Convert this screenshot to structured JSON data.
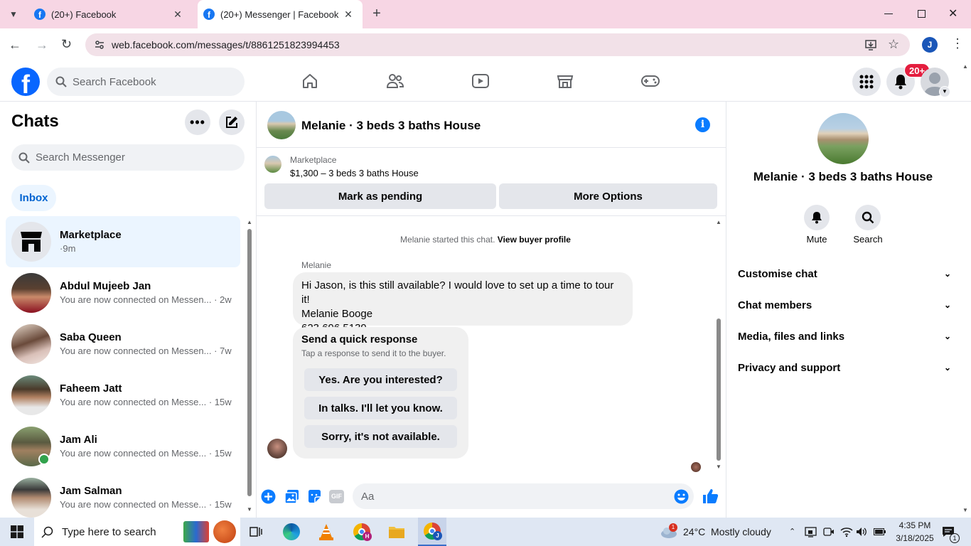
{
  "browser": {
    "tabs": [
      {
        "title": "(20+) Facebook"
      },
      {
        "title": "(20+) Messenger | Facebook"
      }
    ],
    "url": "web.facebook.com/messages/t/8861251823994453",
    "profile_initial": "J"
  },
  "fb": {
    "search_placeholder": "Search Facebook",
    "notification_badge": "20+",
    "logo_letter": "f"
  },
  "sidebar": {
    "title": "Chats",
    "search_placeholder": "Search Messenger",
    "filter_inbox": "Inbox",
    "chats": [
      {
        "name": "Marketplace",
        "snippet": "",
        "time": "9m",
        "selected": true
      },
      {
        "name": "Abdul Mujeeb Jan",
        "snippet": "You are now connected on Messen...",
        "time": "2w"
      },
      {
        "name": "Saba Queen",
        "snippet": "You are now connected on Messen...",
        "time": "7w"
      },
      {
        "name": "Faheem Jatt",
        "snippet": "You are now connected on Messe...",
        "time": "15w"
      },
      {
        "name": "Jam Ali",
        "snippet": "You are now connected on Messe...",
        "time": "15w",
        "online": true
      },
      {
        "name": "Jam Salman",
        "snippet": "You are now connected on Messe...",
        "time": "15w"
      }
    ]
  },
  "conversation": {
    "title": "Melanie · 3 beds 3 baths House",
    "marketplace_label": "Marketplace",
    "listing": "$1,300 – 3 beds 3 baths House",
    "mark_pending": "Mark as pending",
    "more_options": "More Options",
    "started_text": "Melanie started this chat.",
    "view_profile": "View buyer profile",
    "sender": "Melanie",
    "message_lines": [
      "Hi Jason, is this still available? I would love to set up a time to tour it!",
      "Melanie Booge",
      "623 696 5139"
    ],
    "quick_title": "Send a quick response",
    "quick_sub": "Tap a response to send it to the buyer.",
    "quick_responses": [
      "Yes. Are you interested?",
      "In talks. I'll let you know.",
      "Sorry, it's not available."
    ],
    "composer_placeholder": "Aa",
    "gif_label": "GIF"
  },
  "details": {
    "title": "Melanie · 3 beds 3 baths House",
    "mute": "Mute",
    "search": "Search",
    "sections": [
      "Customise chat",
      "Chat members",
      "Media, files and links",
      "Privacy and support"
    ]
  },
  "taskbar": {
    "search_placeholder": "Type here to search",
    "weather": "24°C  Mostly cloudy",
    "weather_badge": "1",
    "time": "4:35 PM",
    "date": "3/18/2025",
    "notification_count": "1"
  },
  "colors": {
    "facebook_blue": "#0866ff",
    "messenger_blue": "#0a7cff",
    "badge_red": "#e41e3f",
    "selected_chat_bg": "#ebf5ff",
    "tab_strip": "#f7d6e4"
  }
}
